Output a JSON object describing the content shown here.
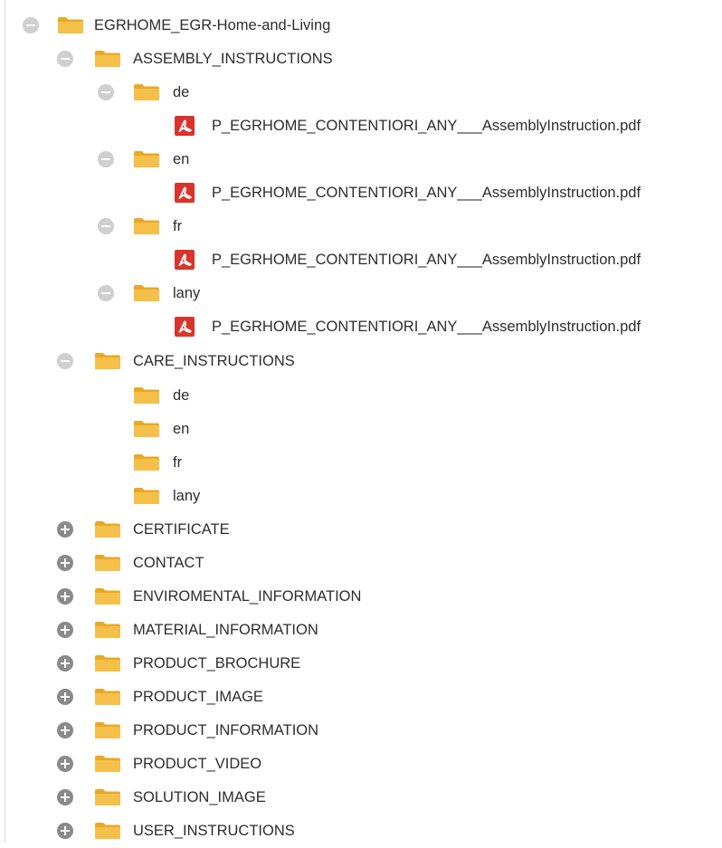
{
  "tree": {
    "root": {
      "label": "EGRHOME_EGR-Home-and-Living"
    },
    "assembly": {
      "label": "ASSEMBLY_INSTRUCTIONS",
      "children": [
        {
          "label": "de",
          "file": "P_EGRHOME_CONTENTIORI_ANY___AssemblyInstruction.pdf"
        },
        {
          "label": "en",
          "file": "P_EGRHOME_CONTENTIORI_ANY___AssemblyInstruction.pdf"
        },
        {
          "label": "fr",
          "file": "P_EGRHOME_CONTENTIORI_ANY___AssemblyInstruction.pdf"
        },
        {
          "label": "lany",
          "file": "P_EGRHOME_CONTENTIORI_ANY___AssemblyInstruction.pdf"
        }
      ]
    },
    "care": {
      "label": "CARE_INSTRUCTIONS",
      "children": [
        {
          "label": "de"
        },
        {
          "label": "en"
        },
        {
          "label": "fr"
        },
        {
          "label": "lany"
        }
      ]
    },
    "collapsed": [
      {
        "label": "CERTIFICATE"
      },
      {
        "label": "CONTACT"
      },
      {
        "label": "ENVIROMENTAL_INFORMATION"
      },
      {
        "label": "MATERIAL_INFORMATION"
      },
      {
        "label": "PRODUCT_BROCHURE"
      },
      {
        "label": "PRODUCT_IMAGE"
      },
      {
        "label": "PRODUCT_INFORMATION"
      },
      {
        "label": "PRODUCT_VIDEO"
      },
      {
        "label": "SOLUTION_IMAGE"
      },
      {
        "label": "USER_INSTRUCTIONS"
      }
    ]
  },
  "icons": {
    "expanded_toggle": "collapse-minus-icon",
    "collapsed_toggle": "expand-plus-icon",
    "folder": "folder-icon",
    "file": "pdf-file-icon"
  },
  "colors": {
    "folder_body": "#f5c04a",
    "folder_tab": "#e9a824",
    "pdf_red": "#d9342b",
    "toggle_expanded": "#cfcfcf",
    "toggle_collapsed": "#8a8a8a",
    "text": "#2d2d2d"
  }
}
